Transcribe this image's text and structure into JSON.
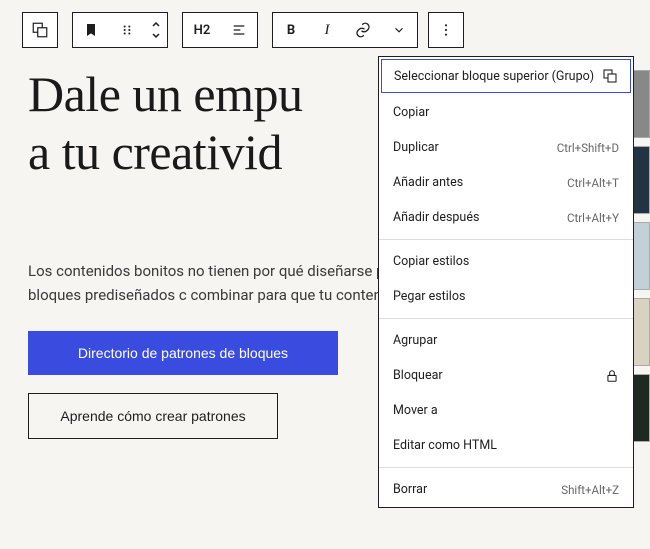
{
  "toolbar": {
    "heading_level": "H2"
  },
  "heading_line1": "Dale un empu",
  "heading_line2": "a tu creativid",
  "paragraph": "Los contenidos bonitos no tienen por qué diseñarse\npatrones son colecciones de bloques prediseñados c\ncombinar para que tu contenido sea impactante, val",
  "buttons": {
    "primary": "Directorio de patrones de bloques",
    "secondary": "Aprende cómo crear patrones"
  },
  "menu": {
    "select_parent": "Seleccionar bloque superior (Grupo)",
    "copy": "Copiar",
    "duplicate": {
      "label": "Duplicar",
      "kbd": "Ctrl+Shift+D"
    },
    "add_before": {
      "label": "Añadir antes",
      "kbd": "Ctrl+Alt+T"
    },
    "add_after": {
      "label": "Añadir después",
      "kbd": "Ctrl+Alt+Y"
    },
    "copy_styles": "Copiar estilos",
    "paste_styles": "Pegar estilos",
    "group": "Agrupar",
    "lock": "Bloquear",
    "move_to": "Mover a",
    "edit_html": "Editar como HTML",
    "delete": {
      "label": "Borrar",
      "kbd": "Shift+Alt+Z"
    }
  }
}
